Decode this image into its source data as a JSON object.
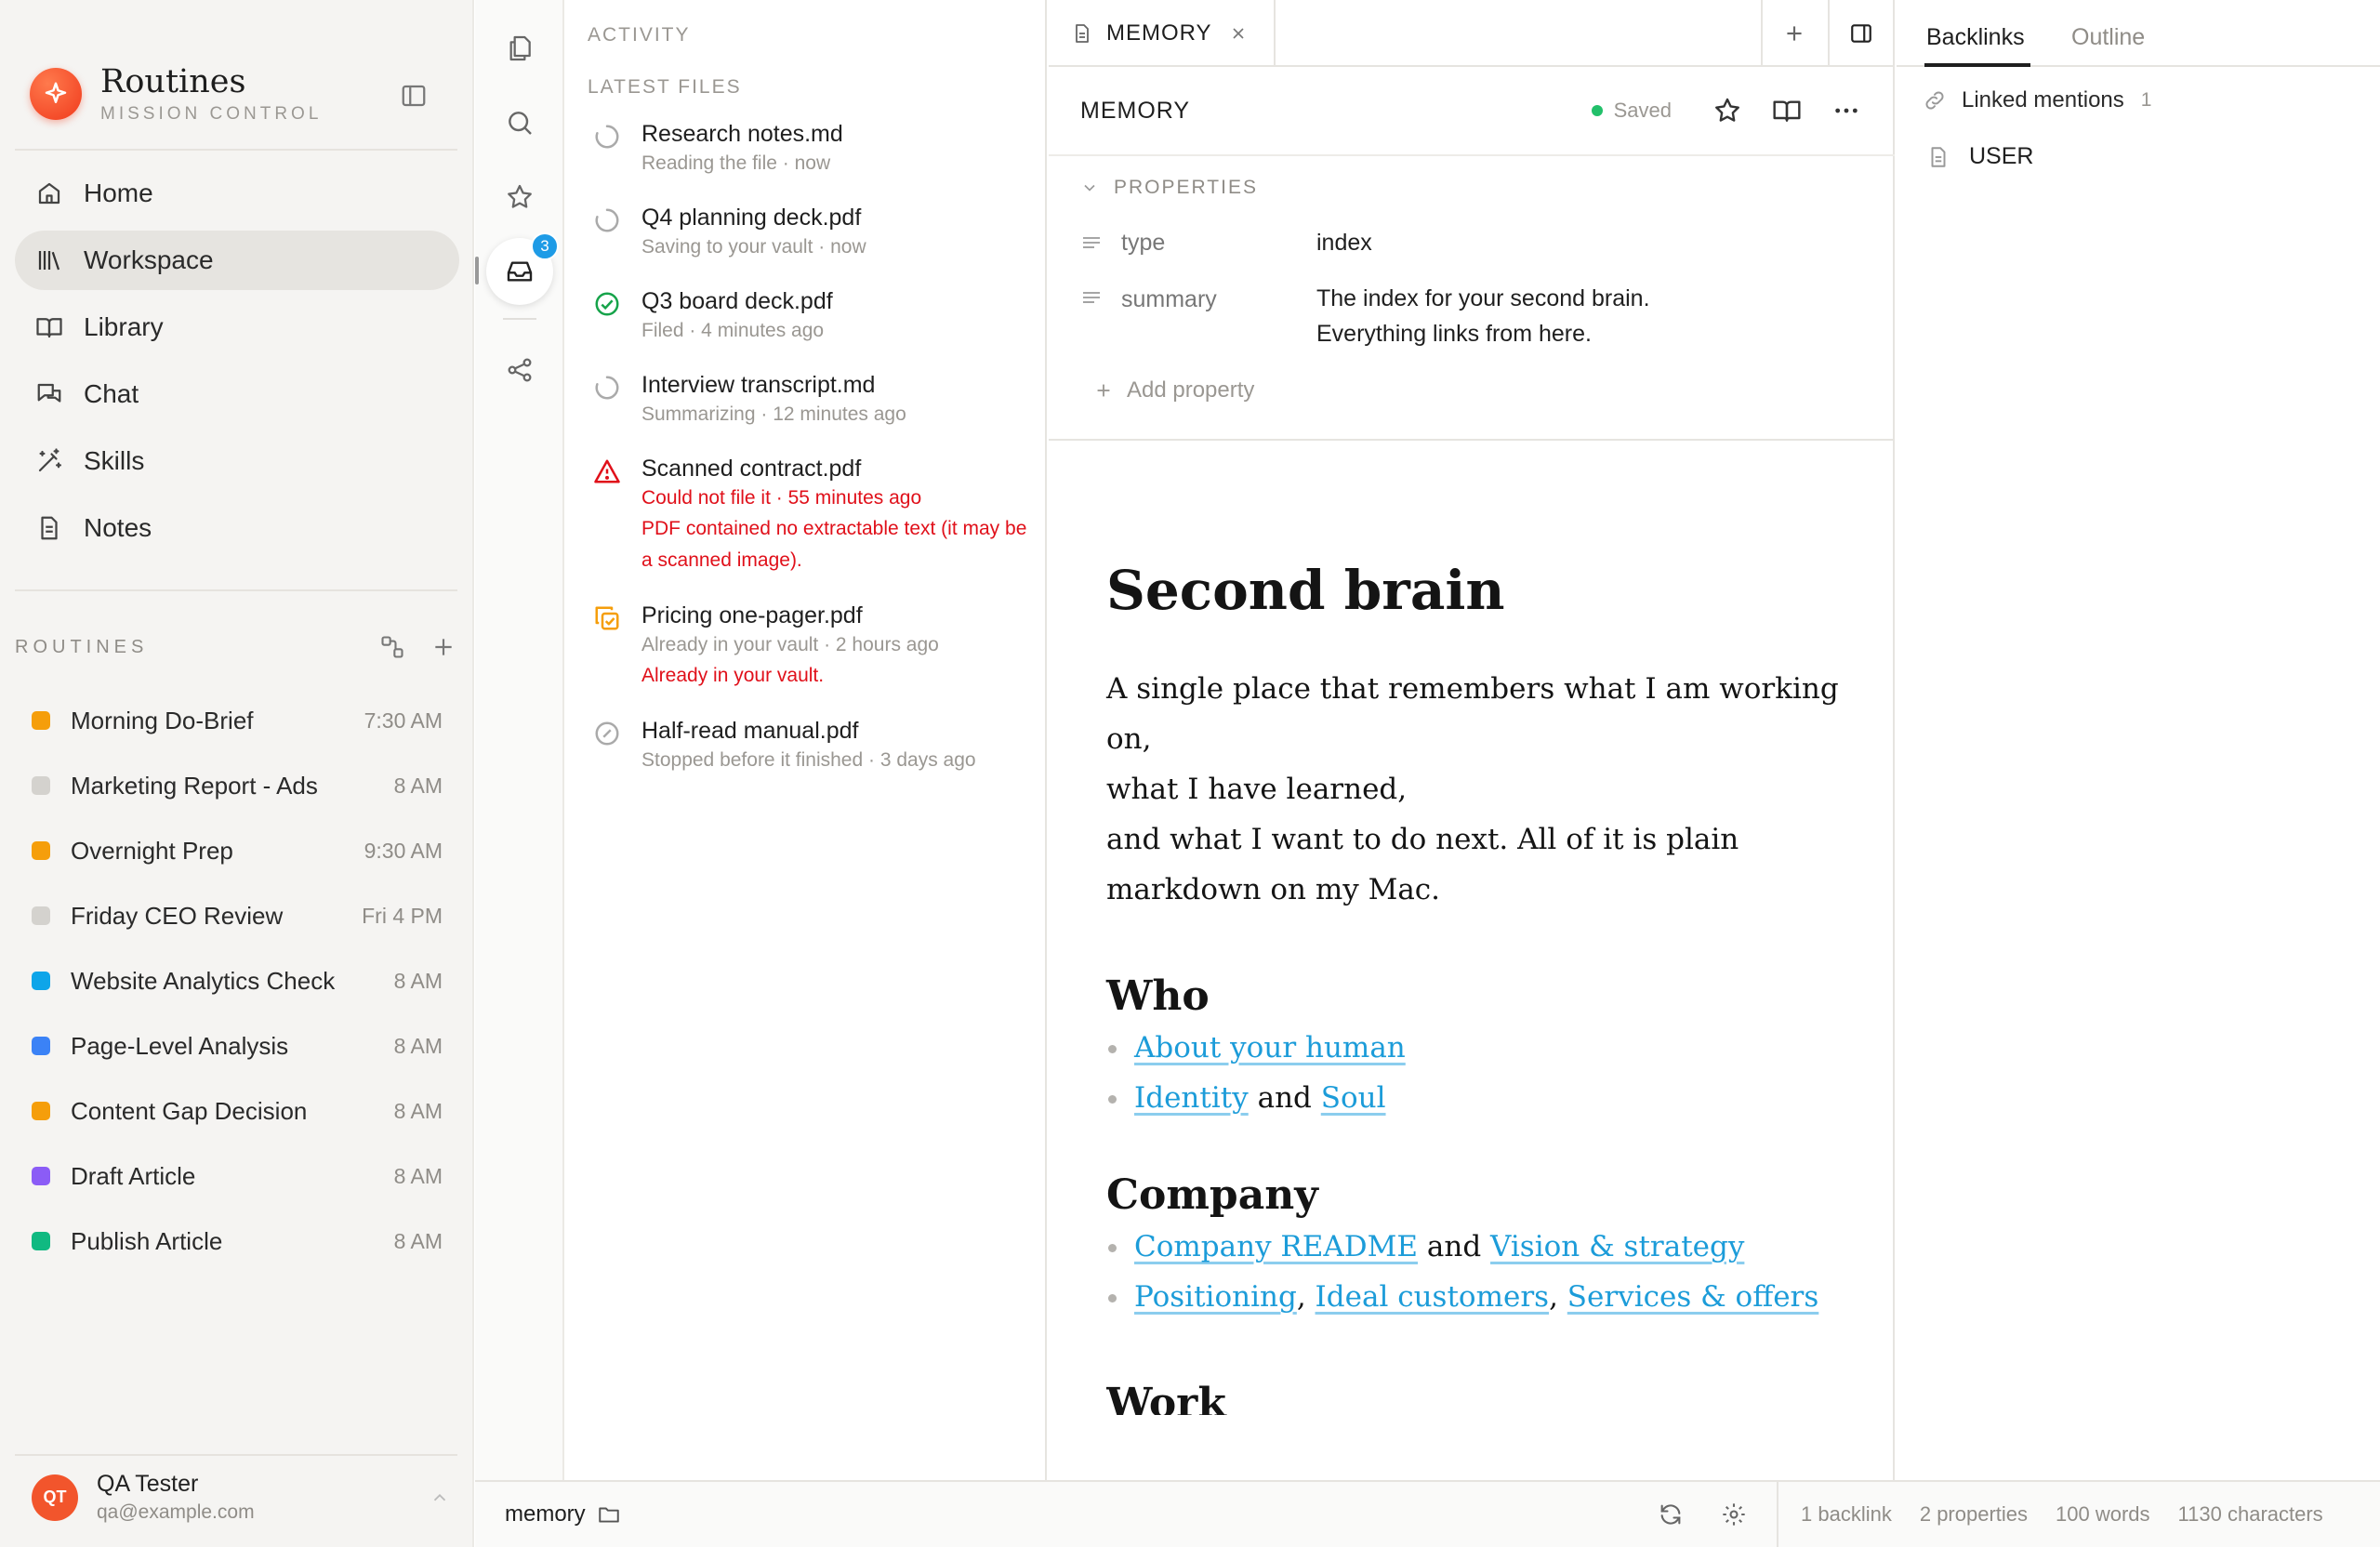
{
  "brand": {
    "name": "Routines",
    "subtitle": "MISSION CONTROL"
  },
  "nav": [
    {
      "label": "Home",
      "icon": "home-icon",
      "active": false
    },
    {
      "label": "Workspace",
      "icon": "library-books-icon",
      "active": true
    },
    {
      "label": "Library",
      "icon": "book-open-icon",
      "active": false
    },
    {
      "label": "Chat",
      "icon": "chat-bubbles-icon",
      "active": false
    },
    {
      "label": "Skills",
      "icon": "magic-wand-icon",
      "active": false
    },
    {
      "label": "Notes",
      "icon": "note-file-icon",
      "active": false
    }
  ],
  "routines": {
    "title": "ROUTINES",
    "items": [
      {
        "name": "Morning Do-Brief",
        "time": "7:30 AM",
        "color": "#f59e0b"
      },
      {
        "name": "Marketing Report - Ads",
        "time": "8 AM",
        "color": "#d4d2ce"
      },
      {
        "name": "Overnight Prep",
        "time": "9:30 AM",
        "color": "#f59e0b"
      },
      {
        "name": "Friday CEO Review",
        "time": "Fri 4 PM",
        "color": "#d4d2ce"
      },
      {
        "name": "Website Analytics Check",
        "time": "8 AM",
        "color": "#0ea5e9"
      },
      {
        "name": "Page-Level Analysis",
        "time": "8 AM",
        "color": "#3b82f6"
      },
      {
        "name": "Content Gap Decision",
        "time": "8 AM",
        "color": "#f59e0b"
      },
      {
        "name": "Draft Article",
        "time": "8 AM",
        "color": "#8b5cf6"
      },
      {
        "name": "Publish Article",
        "time": "8 AM",
        "color": "#10b981"
      }
    ]
  },
  "user": {
    "initials": "QT",
    "name": "QA Tester",
    "email": "qa@example.com"
  },
  "rail": {
    "inbox_badge": "3"
  },
  "activity": {
    "title": "ACTIVITY",
    "section": "LATEST FILES",
    "files": [
      {
        "name": "Research notes.md",
        "meta": "Reading the file · now",
        "status": "in-progress",
        "error": ""
      },
      {
        "name": "Q4 planning deck.pdf",
        "meta": "Saving to your vault · now",
        "status": "in-progress",
        "error": ""
      },
      {
        "name": "Q3 board deck.pdf",
        "meta": "Filed · 4 minutes ago",
        "status": "done",
        "error": ""
      },
      {
        "name": "Interview transcript.md",
        "meta": "Summarizing · 12 minutes ago",
        "status": "in-progress",
        "error": ""
      },
      {
        "name": "Scanned contract.pdf",
        "meta": "Could not file it · 55 minutes ago",
        "status": "error",
        "error": "PDF contained no extractable text (it may be a scanned image)."
      },
      {
        "name": "Pricing one-pager.pdf",
        "meta": "Already in your vault · 2 hours ago",
        "status": "duplicate",
        "error": "Already in your vault."
      },
      {
        "name": "Half-read manual.pdf",
        "meta": "Stopped before it finished · 3 days ago",
        "status": "stopped",
        "error": ""
      }
    ]
  },
  "editor": {
    "tab_label": "MEMORY",
    "doc_title": "MEMORY",
    "saved_label": "Saved",
    "properties": {
      "title": "PROPERTIES",
      "items": [
        {
          "key": "type",
          "value": "index"
        },
        {
          "key": "summary",
          "value": "The index for your second brain. Everything links from here."
        }
      ],
      "add_label": "Add property"
    },
    "doc": {
      "h1": "Second brain",
      "intro_1": "A single place that remembers what I am working on,",
      "intro_2": "what I have learned,",
      "intro_3": "and what I want to do next. All of it is plain markdown on my Mac.",
      "who": "Who",
      "who_l1": "About your human",
      "who_l2a": "Identity",
      "and": "and",
      "who_l2b": "Soul",
      "company": "Company",
      "comp_l1a": "Company README",
      "comp_l1b": "Vision & strategy",
      "comp_l2a": "Positioning",
      "comp_l2b": "Ideal customers",
      "comp_l2c": "Services & offers",
      "comma": ",",
      "work_partial": "Work"
    }
  },
  "backlinks": {
    "tabs": [
      "Backlinks",
      "Outline"
    ],
    "linked_mentions": "Linked mentions",
    "count": "1",
    "items": [
      "USER"
    ]
  },
  "statusbar": {
    "path": "memory",
    "stats": [
      "1 backlink",
      "2 properties",
      "100 words",
      "1130 characters"
    ]
  }
}
